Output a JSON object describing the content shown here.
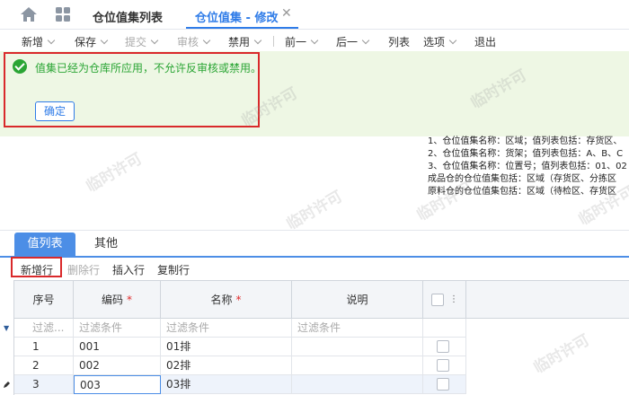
{
  "tabs": {
    "list_title": "仓位值集列表",
    "active_title": "仓位值集 - 修改",
    "close": "✕"
  },
  "toolbar": {
    "new": "新增",
    "save": "保存",
    "submit": "提交",
    "audit": "审核",
    "disable": "禁用",
    "prev": "前一",
    "next": "后一",
    "list": "列表",
    "options": "选项",
    "exit": "退出"
  },
  "message": {
    "text": "值集已经为仓库所应用，不允许反审核或禁用。",
    "confirm": "确定"
  },
  "notes": [
    "1、仓位值集名称：区域；值列表包括：存货区、",
    "2、仓位值集名称：货架；值列表包括：A、B、C",
    "3、仓位值集名称：位置号；值列表包括：01、02",
    "成品仓的仓位值集包括：区域（存货区、分拣区",
    "原料仓的仓位值集包括：区域（待检区、存货区"
  ],
  "watermark": "临时许可",
  "detail_tabs": {
    "values": "值列表",
    "other": "其他"
  },
  "row_toolbar": {
    "new_row": "新增行",
    "delete_row": "删除行",
    "insert_row": "插入行",
    "copy_row": "复制行"
  },
  "grid": {
    "headers": {
      "seq": "序号",
      "code": "编码",
      "name": "名称",
      "desc": "说明",
      "required_mark": "*",
      "more": "⋮"
    },
    "filter": {
      "seq": "过滤...",
      "code": "过滤条件",
      "name": "过滤条件",
      "desc": "过滤条件",
      "marker": "▼"
    },
    "rows": [
      {
        "seq": "1",
        "code": "001",
        "name": "01排",
        "desc": ""
      },
      {
        "seq": "2",
        "code": "002",
        "name": "02排",
        "desc": ""
      },
      {
        "seq": "3",
        "code": "003",
        "name": "03排",
        "desc": ""
      }
    ]
  }
}
